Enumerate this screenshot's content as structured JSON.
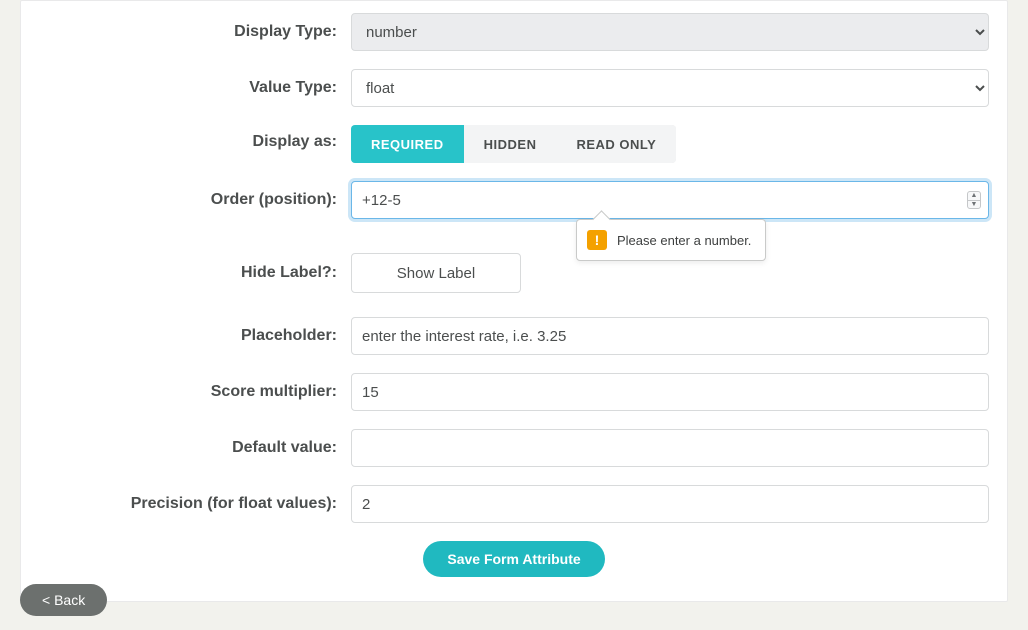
{
  "labels": {
    "display_type": "Display Type:",
    "value_type": "Value Type:",
    "display_as": "Display as:",
    "order": "Order (position):",
    "hide_label": "Hide Label?:",
    "placeholder": "Placeholder:",
    "score_multiplier": "Score multiplier:",
    "default_value": "Default value:",
    "precision": "Precision (for float values):"
  },
  "display_type": {
    "value": "number"
  },
  "value_type": {
    "value": "float"
  },
  "display_as": {
    "options": {
      "required": "REQUIRED",
      "hidden": "HIDDEN",
      "read_only": "READ ONLY"
    },
    "active": "required"
  },
  "order": {
    "value": "+12-5"
  },
  "validation": {
    "message": "Please enter a number."
  },
  "hide_label": {
    "button": "Show Label"
  },
  "placeholder_field": {
    "value": "enter the interest rate, i.e. 3.25"
  },
  "score_multiplier": {
    "value": "15"
  },
  "default_value": {
    "value": ""
  },
  "precision": {
    "value": "2"
  },
  "save_button": "Save Form Attribute",
  "back_button": "< Back"
}
